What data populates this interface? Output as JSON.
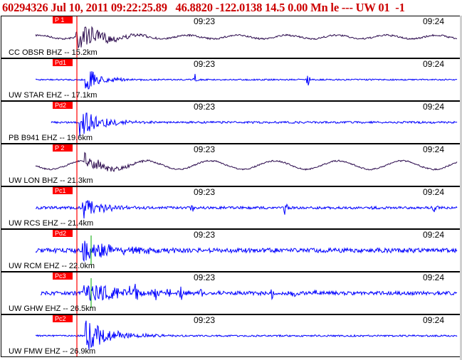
{
  "header": {
    "text": "60294326 Jul 10, 2011 09:22:25.89   46.8820 -122.0138 14.5 0.00 Mn le --- UW 01  -1"
  },
  "colors": {
    "header_text": "#cc0000",
    "trace_blue": "#0000ff",
    "trace_dark": "#2b0a4d",
    "pick_line": "#ff0000",
    "phase_box": "#ff0000",
    "s_marker": "#00aa00"
  },
  "time_ticks": [
    "09:23",
    "09:24"
  ],
  "panels": [
    {
      "station": "CC OBSR BHZ -- 15.2km",
      "phase": "P 1",
      "trace": "dark"
    },
    {
      "station": "UW STAR EHZ -- 17.1km",
      "phase": "Pd1",
      "trace": "blue"
    },
    {
      "station": "PB B941 EHZ -- 19.6km",
      "phase": "Pd2",
      "trace": "blue"
    },
    {
      "station": "UW LON BHZ -- 21.3km",
      "phase": "P 2",
      "trace": "dark"
    },
    {
      "station": "UW RCS EHZ -- 21.4km",
      "phase": "Pc1",
      "trace": "blue"
    },
    {
      "station": "UW RCM EHZ -- 22.0km",
      "phase": "Pd2",
      "trace": "blue"
    },
    {
      "station": "UW GHW EHZ -- 26.5km",
      "phase": "Pc3",
      "trace": "blue"
    },
    {
      "station": "UW FMW EHZ -- 26.9km",
      "phase": "Pc2",
      "trace": "blue"
    }
  ]
}
